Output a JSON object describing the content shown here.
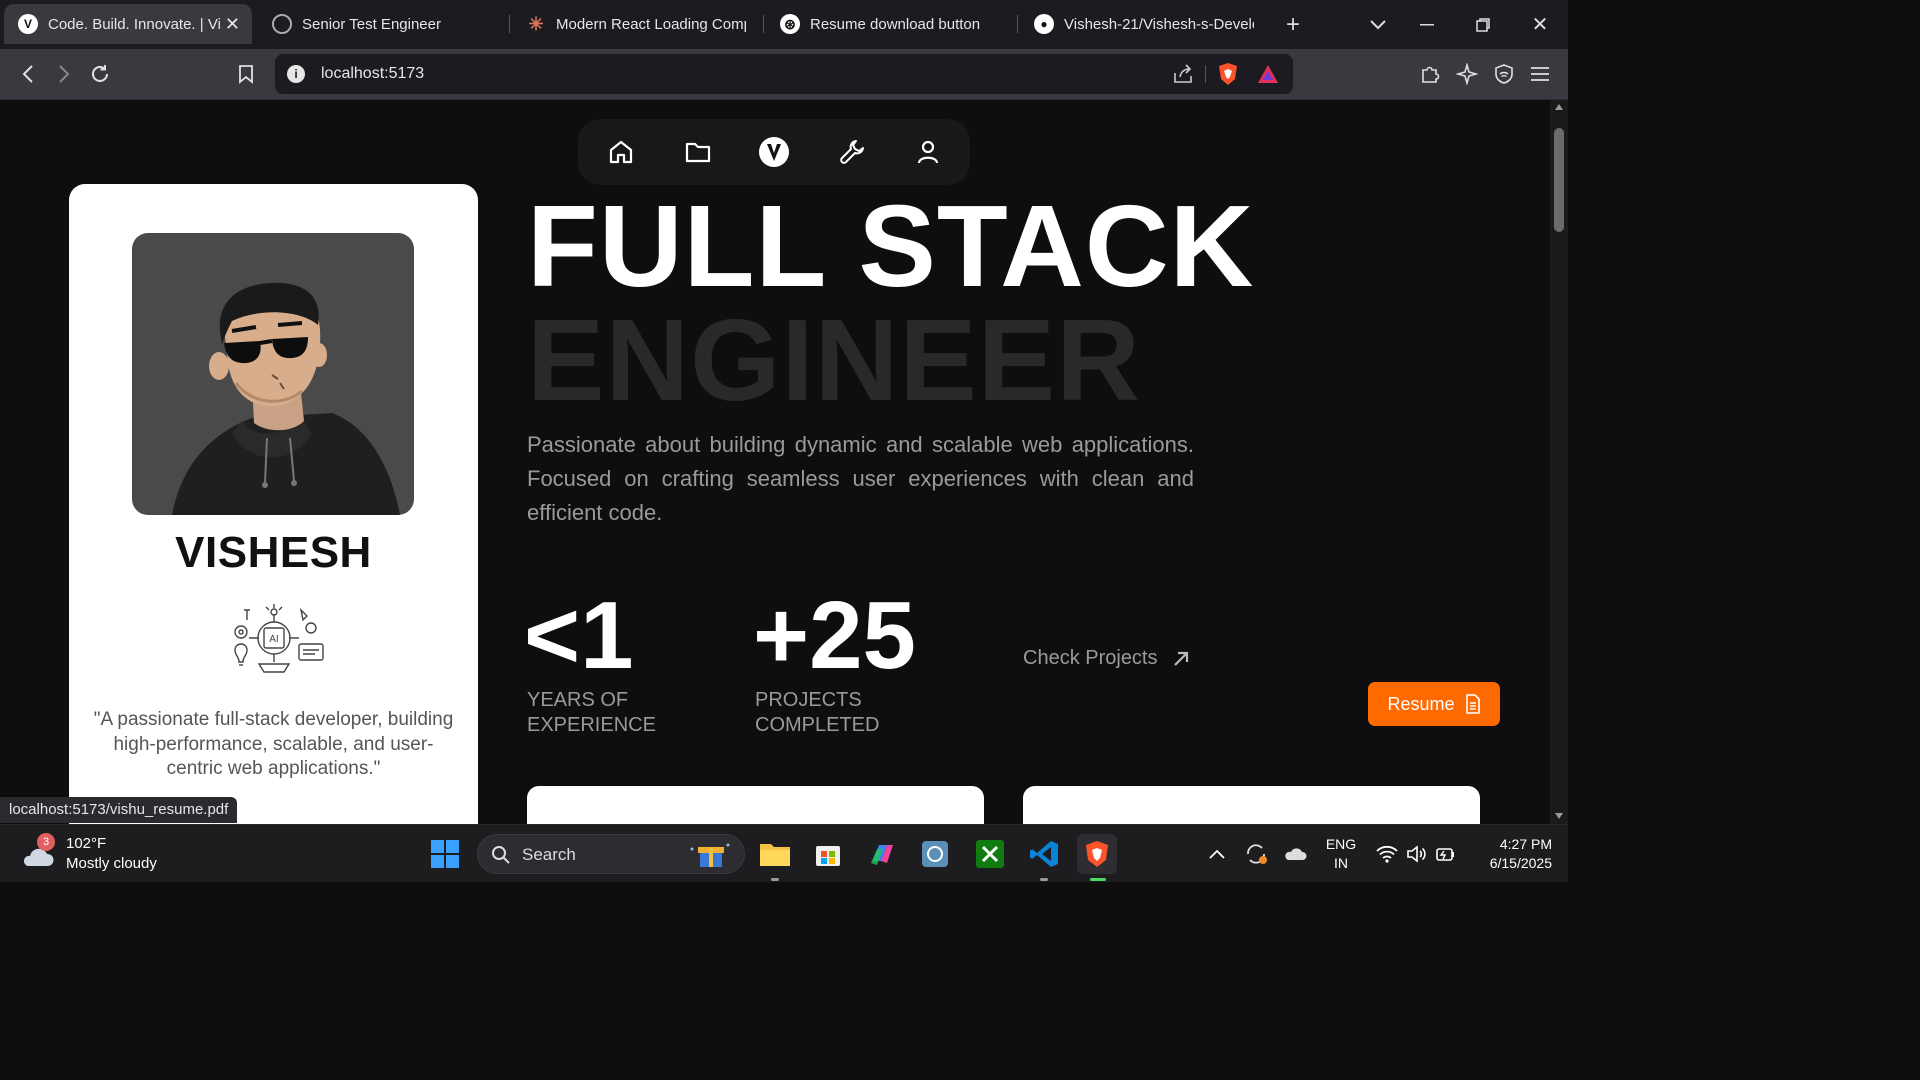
{
  "browser": {
    "tabs": [
      {
        "label": "Code. Build. Innovate. | Vi",
        "icon": "v-logo-icon",
        "active": true
      },
      {
        "label": "Senior Test Engineer",
        "icon": "globe-icon"
      },
      {
        "label": "Modern React Loading Comp",
        "icon": "claude-icon"
      },
      {
        "label": "Resume download button",
        "icon": "openai-icon"
      },
      {
        "label": "Vishesh-21/Vishesh-s-Develo",
        "icon": "github-icon"
      }
    ],
    "url": "localhost:5173"
  },
  "hero": {
    "line1": "FULL STACK",
    "line2": "ENGINEER",
    "description": "Passionate about building dynamic and scalable web applications. Focused on crafting seamless user experiences with clean and efficient code."
  },
  "profile": {
    "name": "VISHESH",
    "quote": "\"A passionate full-stack developer, building high-performance, scalable, and user-centric web applications.\"",
    "ai_chip_label": "AI"
  },
  "stats": [
    {
      "value": "<1",
      "label": "YEARS OF EXPERIENCE"
    },
    {
      "value": "+25",
      "label": "PROJECTS COMPLETED"
    }
  ],
  "actions": {
    "check_projects": "Check Projects",
    "resume": "Resume"
  },
  "status_bar": {
    "link": "localhost:5173/vishu_resume.pdf"
  },
  "taskbar": {
    "weather_temp": "102°F",
    "weather_desc": "Mostly cloudy",
    "weather_badge": "3",
    "search": "Search",
    "lang_1": "ENG",
    "lang_2": "IN",
    "time": "4:27 PM",
    "date": "6/15/2025"
  },
  "colors": {
    "accent": "#ff6a00",
    "background": "#0f0e0e",
    "hero_dim": "#2a2929"
  }
}
